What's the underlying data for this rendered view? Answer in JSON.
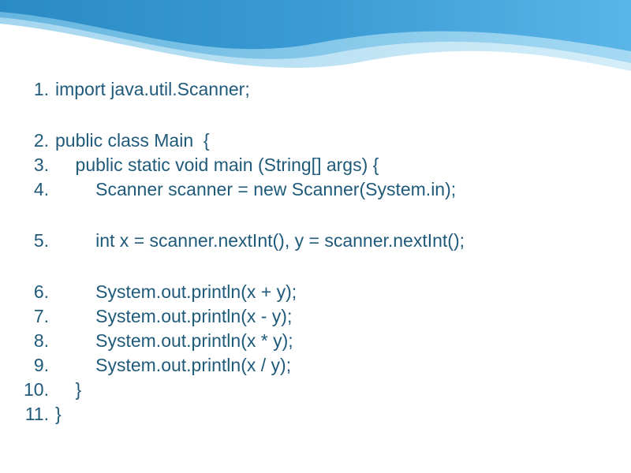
{
  "lines": [
    {
      "n": "1.",
      "text": "import java.util.Scanner;"
    },
    {
      "n": "",
      "text": "",
      "blank": true
    },
    {
      "n": "2.",
      "text": "public class Main  {"
    },
    {
      "n": "3.",
      "text": "    public static void main (String[] args) {"
    },
    {
      "n": "4.",
      "text": "        Scanner scanner = new Scanner(System.in);"
    },
    {
      "n": "",
      "text": "",
      "blank": true
    },
    {
      "n": "5.",
      "text": "        int x = scanner.nextInt(), y = scanner.nextInt();"
    },
    {
      "n": "",
      "text": "",
      "blank": true
    },
    {
      "n": "6.",
      "text": "        System.out.println(x + y);"
    },
    {
      "n": "7.",
      "text": "        System.out.println(x - y);"
    },
    {
      "n": "8.",
      "text": "        System.out.println(x * y);"
    },
    {
      "n": "9.",
      "text": "        System.out.println(x / y);"
    },
    {
      "n": "10.",
      "text": "    }"
    },
    {
      "n": "11.",
      "text": "}"
    }
  ]
}
